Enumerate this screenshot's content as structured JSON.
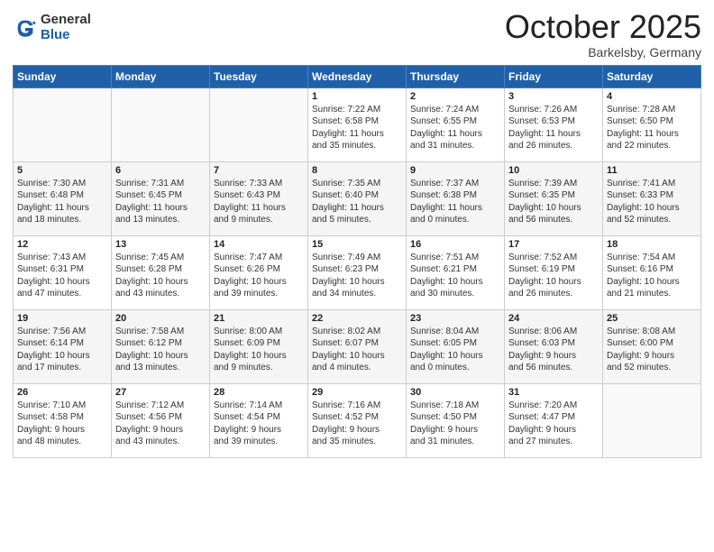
{
  "header": {
    "logo_general": "General",
    "logo_blue": "Blue",
    "month": "October 2025",
    "location": "Barkelsby, Germany"
  },
  "days_of_week": [
    "Sunday",
    "Monday",
    "Tuesday",
    "Wednesday",
    "Thursday",
    "Friday",
    "Saturday"
  ],
  "weeks": [
    [
      {
        "day": "",
        "content": ""
      },
      {
        "day": "",
        "content": ""
      },
      {
        "day": "",
        "content": ""
      },
      {
        "day": "1",
        "content": "Sunrise: 7:22 AM\nSunset: 6:58 PM\nDaylight: 11 hours\nand 35 minutes."
      },
      {
        "day": "2",
        "content": "Sunrise: 7:24 AM\nSunset: 6:55 PM\nDaylight: 11 hours\nand 31 minutes."
      },
      {
        "day": "3",
        "content": "Sunrise: 7:26 AM\nSunset: 6:53 PM\nDaylight: 11 hours\nand 26 minutes."
      },
      {
        "day": "4",
        "content": "Sunrise: 7:28 AM\nSunset: 6:50 PM\nDaylight: 11 hours\nand 22 minutes."
      }
    ],
    [
      {
        "day": "5",
        "content": "Sunrise: 7:30 AM\nSunset: 6:48 PM\nDaylight: 11 hours\nand 18 minutes."
      },
      {
        "day": "6",
        "content": "Sunrise: 7:31 AM\nSunset: 6:45 PM\nDaylight: 11 hours\nand 13 minutes."
      },
      {
        "day": "7",
        "content": "Sunrise: 7:33 AM\nSunset: 6:43 PM\nDaylight: 11 hours\nand 9 minutes."
      },
      {
        "day": "8",
        "content": "Sunrise: 7:35 AM\nSunset: 6:40 PM\nDaylight: 11 hours\nand 5 minutes."
      },
      {
        "day": "9",
        "content": "Sunrise: 7:37 AM\nSunset: 6:38 PM\nDaylight: 11 hours\nand 0 minutes."
      },
      {
        "day": "10",
        "content": "Sunrise: 7:39 AM\nSunset: 6:35 PM\nDaylight: 10 hours\nand 56 minutes."
      },
      {
        "day": "11",
        "content": "Sunrise: 7:41 AM\nSunset: 6:33 PM\nDaylight: 10 hours\nand 52 minutes."
      }
    ],
    [
      {
        "day": "12",
        "content": "Sunrise: 7:43 AM\nSunset: 6:31 PM\nDaylight: 10 hours\nand 47 minutes."
      },
      {
        "day": "13",
        "content": "Sunrise: 7:45 AM\nSunset: 6:28 PM\nDaylight: 10 hours\nand 43 minutes."
      },
      {
        "day": "14",
        "content": "Sunrise: 7:47 AM\nSunset: 6:26 PM\nDaylight: 10 hours\nand 39 minutes."
      },
      {
        "day": "15",
        "content": "Sunrise: 7:49 AM\nSunset: 6:23 PM\nDaylight: 10 hours\nand 34 minutes."
      },
      {
        "day": "16",
        "content": "Sunrise: 7:51 AM\nSunset: 6:21 PM\nDaylight: 10 hours\nand 30 minutes."
      },
      {
        "day": "17",
        "content": "Sunrise: 7:52 AM\nSunset: 6:19 PM\nDaylight: 10 hours\nand 26 minutes."
      },
      {
        "day": "18",
        "content": "Sunrise: 7:54 AM\nSunset: 6:16 PM\nDaylight: 10 hours\nand 21 minutes."
      }
    ],
    [
      {
        "day": "19",
        "content": "Sunrise: 7:56 AM\nSunset: 6:14 PM\nDaylight: 10 hours\nand 17 minutes."
      },
      {
        "day": "20",
        "content": "Sunrise: 7:58 AM\nSunset: 6:12 PM\nDaylight: 10 hours\nand 13 minutes."
      },
      {
        "day": "21",
        "content": "Sunrise: 8:00 AM\nSunset: 6:09 PM\nDaylight: 10 hours\nand 9 minutes."
      },
      {
        "day": "22",
        "content": "Sunrise: 8:02 AM\nSunset: 6:07 PM\nDaylight: 10 hours\nand 4 minutes."
      },
      {
        "day": "23",
        "content": "Sunrise: 8:04 AM\nSunset: 6:05 PM\nDaylight: 10 hours\nand 0 minutes."
      },
      {
        "day": "24",
        "content": "Sunrise: 8:06 AM\nSunset: 6:03 PM\nDaylight: 9 hours\nand 56 minutes."
      },
      {
        "day": "25",
        "content": "Sunrise: 8:08 AM\nSunset: 6:00 PM\nDaylight: 9 hours\nand 52 minutes."
      }
    ],
    [
      {
        "day": "26",
        "content": "Sunrise: 7:10 AM\nSunset: 4:58 PM\nDaylight: 9 hours\nand 48 minutes."
      },
      {
        "day": "27",
        "content": "Sunrise: 7:12 AM\nSunset: 4:56 PM\nDaylight: 9 hours\nand 43 minutes."
      },
      {
        "day": "28",
        "content": "Sunrise: 7:14 AM\nSunset: 4:54 PM\nDaylight: 9 hours\nand 39 minutes."
      },
      {
        "day": "29",
        "content": "Sunrise: 7:16 AM\nSunset: 4:52 PM\nDaylight: 9 hours\nand 35 minutes."
      },
      {
        "day": "30",
        "content": "Sunrise: 7:18 AM\nSunset: 4:50 PM\nDaylight: 9 hours\nand 31 minutes."
      },
      {
        "day": "31",
        "content": "Sunrise: 7:20 AM\nSunset: 4:47 PM\nDaylight: 9 hours\nand 27 minutes."
      },
      {
        "day": "",
        "content": ""
      }
    ]
  ]
}
